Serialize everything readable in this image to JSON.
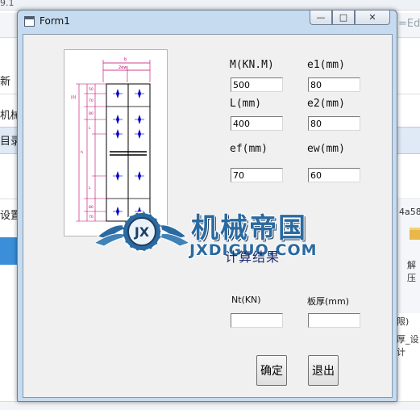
{
  "background": {
    "version_text": "9.1",
    "address_tail": "=Ed",
    "left_labels": [
      "新",
      "机械",
      "目录",
      "设置"
    ],
    "right_labels": [
      "4a58",
      "解压",
      "限)",
      "厚_设计"
    ]
  },
  "window": {
    "title": "Form1",
    "minimize_glyph": "—",
    "maximize_glyph": "□",
    "close_glyph": "✕"
  },
  "inputs": {
    "m": {
      "label": "M(KN.M)",
      "value": "500"
    },
    "e1": {
      "label": "e1(mm)",
      "value": "80"
    },
    "l": {
      "label": "L(mm)",
      "value": "400"
    },
    "e2": {
      "label": "e2(mm)",
      "value": "80"
    },
    "ef": {
      "label": "ef(mm)",
      "value": "70"
    },
    "ew": {
      "label": "ew(mm)",
      "value": "60"
    }
  },
  "results": {
    "title": "计算结果",
    "nt": {
      "label": "Nt(KN)",
      "value": ""
    },
    "thickness": {
      "label": "板厚(mm)",
      "value": ""
    }
  },
  "buttons": {
    "ok": "确定",
    "exit": "退出"
  },
  "watermark": {
    "chinese": "机械帝国",
    "english": "JXDIGUO.COM",
    "emblem_text": "JX"
  },
  "colors": {
    "window_frame": "#c6dbef",
    "client_bg": "#f0f0f0",
    "result_title": "#1d2c6b",
    "watermark": "#2a6aa0"
  }
}
